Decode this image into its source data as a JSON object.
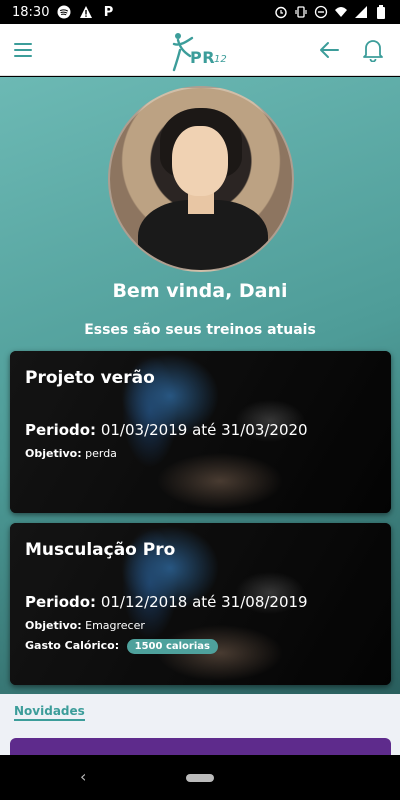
{
  "status_bar": {
    "time": "18:30",
    "left_icons": [
      "spotify-icon",
      "warning-icon",
      "p-icon"
    ],
    "right_icons": [
      "alarm-icon",
      "vibrate-icon",
      "dnd-icon",
      "wifi-icon",
      "signal-icon",
      "battery-icon"
    ]
  },
  "app_bar": {
    "logo_text": "PR",
    "logo_sub": "12",
    "accent_color": "#3c9d9a"
  },
  "profile": {
    "welcome": "Bem vinda, Dani",
    "subtitle": "Esses são seus treinos atuais"
  },
  "workouts": [
    {
      "title": "Projeto verão",
      "period_label": "Periodo:",
      "period_value": "01/03/2019 até 31/03/2020",
      "objective_label": "Objetivo:",
      "objective_value": "perda"
    },
    {
      "title": "Musculação Pro",
      "period_label": "Periodo:",
      "period_value": "01/12/2018 até 31/08/2019",
      "objective_label": "Objetivo:",
      "objective_value": "Emagrecer",
      "calories_label": "Gasto Calórico:",
      "calories_value": "1500 calorias"
    }
  ],
  "news": {
    "label": "Novidades",
    "card_color": "#5e2b8c"
  }
}
